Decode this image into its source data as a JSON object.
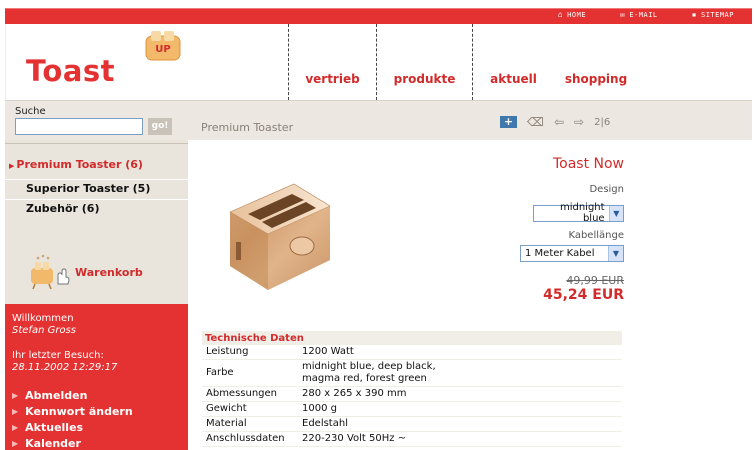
{
  "top_links": [
    {
      "icon": "home-icon",
      "glyph": "⌂",
      "label": "HOME"
    },
    {
      "icon": "email-icon",
      "glyph": "✉",
      "label": "E-MAIL"
    },
    {
      "icon": "sitemap-icon",
      "glyph": "▪",
      "label": "SITEMAP"
    }
  ],
  "brand": {
    "logo_text": "Toast",
    "badge_text": "UP"
  },
  "nav": [
    "vertrieb",
    "produkte",
    "aktuell",
    "shopping"
  ],
  "search": {
    "label": "Suche",
    "value": "",
    "button": "go!"
  },
  "breadcrumb": "Premium Toaster",
  "pager": "2|6",
  "categories": [
    {
      "label": "Premium Toaster (6)",
      "active": true
    },
    {
      "label": "Superior Toaster (5)",
      "active": false
    },
    {
      "label": "Zubehör (6)",
      "active": false
    }
  ],
  "cart": {
    "label": "Warenkorb"
  },
  "user": {
    "welcome": "Willkommen",
    "name": "Stefan Gross",
    "last_visit_label": "Ihr letzter Besuch:",
    "last_visit": "28.11.2002 12:29:17",
    "menu": [
      "Abmelden",
      "Kennwort ändern",
      "Aktuelles",
      "Kalender"
    ]
  },
  "product": {
    "title": "Toast Now",
    "design_label": "Design",
    "design_value": "midnight blue",
    "cable_label": "Kabellänge",
    "cable_value": "1 Meter Kabel",
    "price_old": "49,99 EUR",
    "price_new": "45,24 EUR"
  },
  "tech": {
    "heading": "Technische Daten",
    "rows": [
      {
        "k": "Leistung",
        "v": "1200 Watt"
      },
      {
        "k": "Farbe",
        "v": "midnight blue, deep black,\nmagma red, forest green"
      },
      {
        "k": "Abmessungen",
        "v": "280 x 265 x 390 mm"
      },
      {
        "k": "Gewicht",
        "v": "1000 g"
      },
      {
        "k": "Material",
        "v": "Edelstahl"
      },
      {
        "k": "Anschlussdaten",
        "v": "220-230 Volt 50Hz ~"
      }
    ]
  },
  "colors": {
    "brand_red": "#e43131",
    "sidebar_beige": "#e9e4dc"
  }
}
